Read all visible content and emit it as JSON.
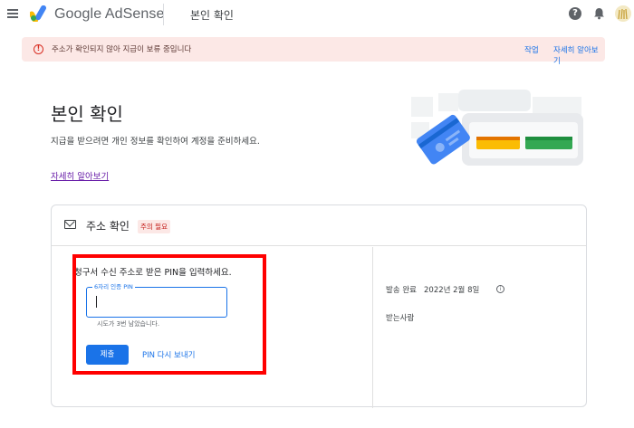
{
  "header": {
    "brand": "Google AdSense",
    "page_title": "본인 확인",
    "help_icon": "?",
    "icons": [
      "menu-icon",
      "help-icon",
      "bell-icon",
      "avatar"
    ]
  },
  "alert": {
    "icon": "!",
    "text": "주소가 확인되지 않아 지급이 보류 중입니다",
    "action_primary": "작업",
    "action_secondary": "자세히 알아보기",
    "color": "#fce8e6"
  },
  "hero": {
    "title": "본인 확인",
    "description": "지급을 받으려면 개인 정보를 확인하여 계정을 준비하세요.",
    "link": "자세히 알아보기"
  },
  "card": {
    "title": "주소 확인",
    "badge": "주의 필요",
    "instruction": "청구서 수신 주소로 받은 PIN을 입력하세요.",
    "pin_label": "6자리 인증 PIN",
    "pin_value": "",
    "attempts_text": "시도가 3번 남았습니다.",
    "submit_label": "제출",
    "resend_label": "PIN 다시 보내기",
    "sent_label": "발송 완료",
    "sent_date": "2022년 2월 8일",
    "info_icon": "i",
    "recipient_label": "받는사람"
  },
  "colors": {
    "accent": "#1a73e8",
    "highlight": "#ff0000",
    "warning": "#d93025"
  }
}
